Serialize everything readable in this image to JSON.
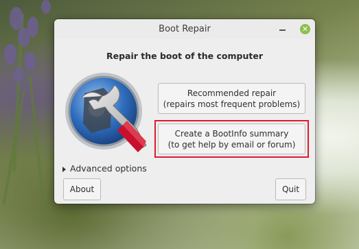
{
  "window": {
    "title": "Boot Repair",
    "heading": "Repair the boot of the computer"
  },
  "buttons": {
    "recommended_line1": "Recommended repair",
    "recommended_line2": "(repairs most frequent problems)",
    "bootinfo_line1": "Create a BootInfo summary",
    "bootinfo_line2": "(to get help by email or forum)",
    "about": "About",
    "quit": "Quit"
  },
  "advanced_label": "Advanced options",
  "icons": {
    "minimize": "minimize-icon",
    "close": "close-icon",
    "logo": "boot-repair-wrench-logo",
    "expander": "triangle-right-icon"
  },
  "colors": {
    "close_button": "#8cbf4a",
    "highlight": "#e0182f",
    "logo_handle": "#c8102e"
  }
}
